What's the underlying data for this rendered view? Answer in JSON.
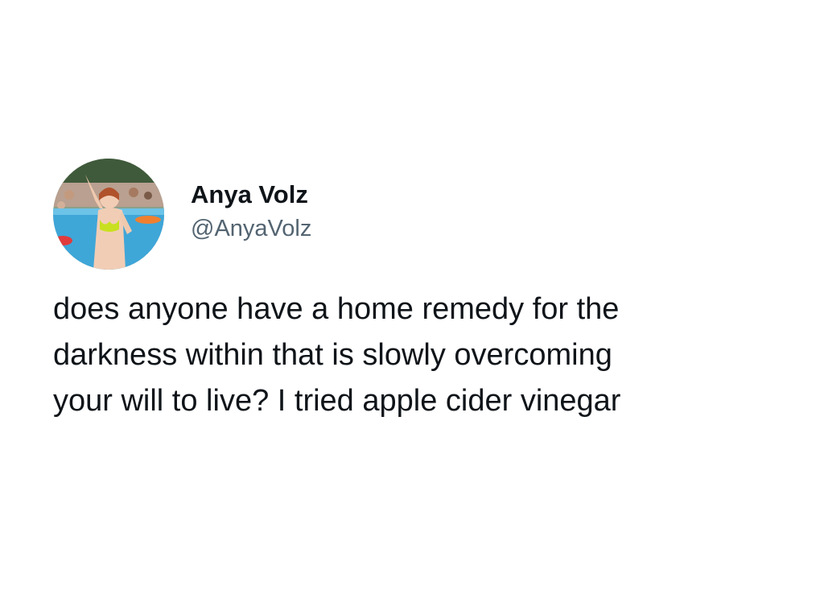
{
  "author": {
    "display_name": "Anya Volz",
    "handle": "@AnyaVolz",
    "avatar_icon": "profile-photo"
  },
  "tweet": {
    "lines": [
      "does anyone have a home remedy for the",
      "darkness within that is slowly overcoming",
      "your will to live? I tried apple cider vinegar"
    ]
  },
  "colors": {
    "background": "#ffffff",
    "text_primary": "#0f1419",
    "text_secondary": "#536471"
  }
}
